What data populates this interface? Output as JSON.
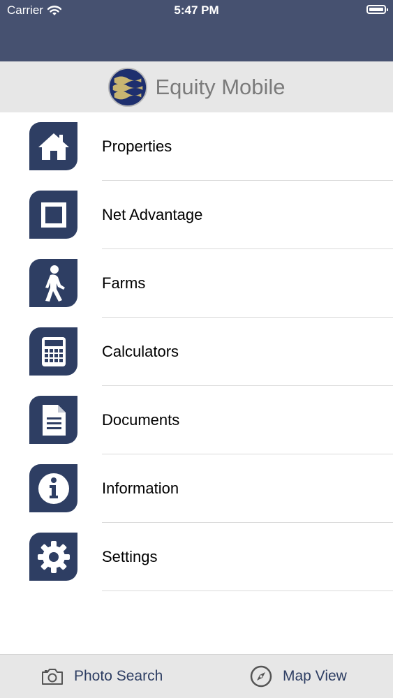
{
  "status": {
    "carrier": "Carrier",
    "time": "5:47 PM"
  },
  "header": {
    "title": "Equity Mobile",
    "logo_icon": "equity-waves-logo"
  },
  "menu": {
    "items": [
      {
        "label": "Properties",
        "icon": "house-icon"
      },
      {
        "label": "Net Advantage",
        "icon": "square-icon"
      },
      {
        "label": "Farms",
        "icon": "walking-person-icon"
      },
      {
        "label": "Calculators",
        "icon": "calculator-icon"
      },
      {
        "label": "Documents",
        "icon": "document-icon"
      },
      {
        "label": "Information",
        "icon": "info-icon"
      },
      {
        "label": "Settings",
        "icon": "gear-icon"
      }
    ]
  },
  "tabbar": {
    "photo_search": {
      "label": "Photo Search",
      "icon": "camera-icon"
    },
    "map_view": {
      "label": "Map View",
      "icon": "compass-icon"
    }
  },
  "colors": {
    "status_bg": "#465170",
    "accent": "#2e3e63",
    "header_bg": "#e7e7e7",
    "logo_gold": "#c9b571"
  }
}
